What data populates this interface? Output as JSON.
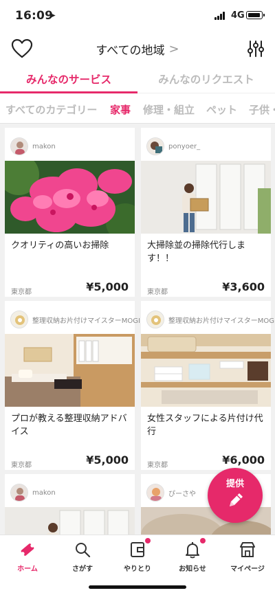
{
  "status_bar": {
    "time": "16:09",
    "network": "4G"
  },
  "header": {
    "region": "すべての地域",
    "region_chevron": ">"
  },
  "tabs": [
    {
      "label": "みんなのサービス",
      "active": true
    },
    {
      "label": "みんなのリクエスト",
      "active": false
    }
  ],
  "categories": [
    {
      "label": "すべてのカテゴリー",
      "active": false
    },
    {
      "label": "家事",
      "active": true
    },
    {
      "label": "修理・組立",
      "active": false
    },
    {
      "label": "ペット",
      "active": false
    },
    {
      "label": "子供・",
      "active": false
    }
  ],
  "cards": [
    {
      "username": "makon",
      "title": "クオリティの高いお掃除",
      "area": "東京都",
      "price": "¥5,000"
    },
    {
      "username": "ponyoer_",
      "title": "大掃除並の掃除代行します！！",
      "area": "東京都",
      "price": "¥3,600"
    },
    {
      "username": "整理収納お片付けマイスターMOGI",
      "title": "プロが教える整理収納アドバイス",
      "area": "東京都",
      "price": "¥5,000"
    },
    {
      "username": "整理収納お片付けマイスターMOGI",
      "title": "女性スタッフによる片付け代行",
      "area": "東京都",
      "price": "¥6,000"
    },
    {
      "username": "makon",
      "title": "",
      "area": "",
      "price": ""
    },
    {
      "username": "ぴーさや",
      "title": "",
      "area": "",
      "price": ""
    }
  ],
  "fab": {
    "label": "提供",
    "icon": "pencil-icon"
  },
  "bottom_nav": [
    {
      "label": "ホーム",
      "icon": "ticket-icon",
      "active": true,
      "badge": false
    },
    {
      "label": "さがす",
      "icon": "search-icon",
      "active": false,
      "badge": false
    },
    {
      "label": "やりとり",
      "icon": "wallet-icon",
      "active": false,
      "badge": true
    },
    {
      "label": "お知らせ",
      "icon": "bell-icon",
      "active": false,
      "badge": true
    },
    {
      "label": "マイページ",
      "icon": "shop-icon",
      "active": false,
      "badge": false
    }
  ],
  "colors": {
    "accent": "#e6296a",
    "inactive_text": "#bbbbbb",
    "grid_background": "#f1f1f1"
  }
}
